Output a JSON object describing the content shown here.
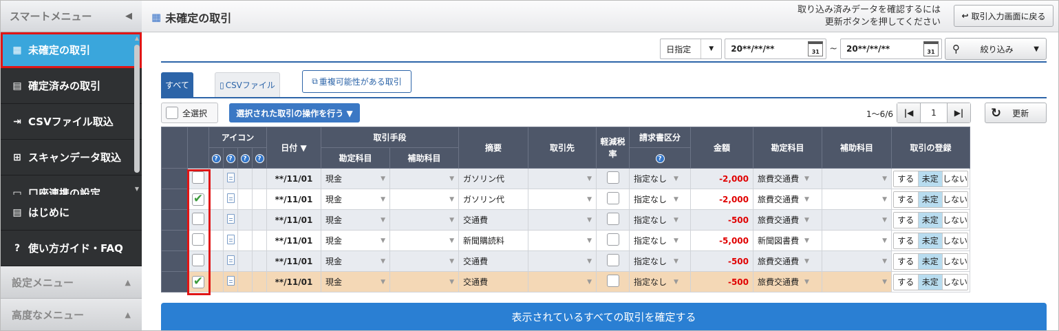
{
  "sidebar": {
    "title": "スマートメニュー",
    "scroll_items": [
      {
        "label": "未確定の取引",
        "active": true
      },
      {
        "label": "確定済みの取引"
      },
      {
        "label": "CSVファイル取込"
      },
      {
        "label": "スキャンデータ取込"
      },
      {
        "label": "口座連携の設定"
      }
    ],
    "fixed_items": [
      {
        "label": "はじめに"
      },
      {
        "label": "使い方ガイド・FAQ"
      }
    ],
    "groups": [
      {
        "label": "設定メニュー"
      },
      {
        "label": "高度なメニュー"
      }
    ]
  },
  "header": {
    "title": "未確定の取引",
    "note_line1": "取り込み済みデータを確認するには",
    "note_line2": "更新ボタンを押してください",
    "back_label": "取引入力画面に戻る"
  },
  "filter": {
    "date_mode": "日指定",
    "date_from": "20**/**/**",
    "date_to": "20**/**/**",
    "tilde": "~",
    "filter_label": "絞り込み"
  },
  "tabs": {
    "all": "すべて",
    "csv": "CSVファイル",
    "dup": "重複可能性がある取引"
  },
  "toolbar": {
    "select_all": "全選択",
    "ops": "選択された取引の操作を行う ▼",
    "count": "1～6/6",
    "page": "1",
    "refresh": "更新"
  },
  "table": {
    "headers": {
      "icon": "アイコン",
      "date": "日付 ▼",
      "method": "取引手段",
      "method_account": "勘定科目",
      "method_sub": "補助科目",
      "summary": "摘要",
      "partner": "取引先",
      "reduced": "軽減税率",
      "invoice": "請求書区分",
      "amount": "金額",
      "account": "勘定科目",
      "sub": "補助科目",
      "register": "取引の登録"
    },
    "help_glyph": "?",
    "register_options": [
      "する",
      "未定",
      "しない"
    ],
    "rows": [
      {
        "checked": false,
        "date": "**/11/01",
        "method": "現金",
        "summary": "ガソリン代",
        "invoice": "指定なし",
        "amount": "-2,000",
        "account": "旅費交通費",
        "register": "未定"
      },
      {
        "checked": true,
        "date": "**/11/01",
        "method": "現金",
        "summary": "ガソリン代",
        "invoice": "指定なし",
        "amount": "-2,000",
        "account": "旅費交通費",
        "register": "未定"
      },
      {
        "checked": false,
        "date": "**/11/01",
        "method": "現金",
        "summary": "交通費",
        "invoice": "指定なし",
        "amount": "-500",
        "account": "旅費交通費",
        "register": "未定"
      },
      {
        "checked": false,
        "date": "**/11/01",
        "method": "現金",
        "summary": "新聞購読料",
        "invoice": "指定なし",
        "amount": "-5,000",
        "account": "新聞図書費",
        "register": "未定"
      },
      {
        "checked": false,
        "date": "**/11/01",
        "method": "現金",
        "summary": "交通費",
        "invoice": "指定なし",
        "amount": "-500",
        "account": "旅費交通費",
        "register": "未定"
      },
      {
        "checked": true,
        "date": "**/11/01",
        "method": "現金",
        "summary": "交通費",
        "invoice": "指定なし",
        "amount": "-500",
        "account": "旅費交通費",
        "register": "未定",
        "highlight": true
      }
    ]
  },
  "confirm_label": "表示されているすべての取引を確定する"
}
